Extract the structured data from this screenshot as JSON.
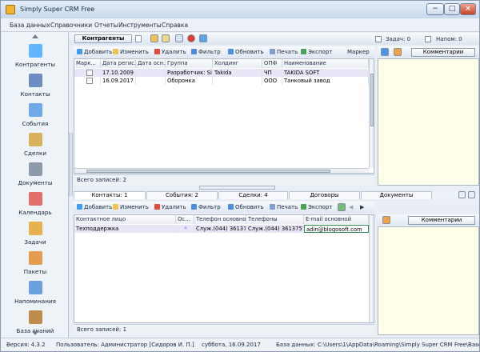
{
  "window": {
    "title": "Simply Super CRM Free",
    "min_label": "−",
    "max_label": "□",
    "close_label": "×"
  },
  "menu": [
    "База данных",
    "Справочники",
    "Отчеты",
    "Инструменты",
    "Справка"
  ],
  "sidebar": {
    "items": [
      {
        "label": "Контрагенты",
        "icon": "diamond-icon",
        "color": "#62b6ff"
      },
      {
        "label": "Контакты",
        "icon": "address-book-icon",
        "color": "#6f8cc2"
      },
      {
        "label": "События",
        "icon": "window-stack-icon",
        "color": "#6fa9e8"
      },
      {
        "label": "Сделки",
        "icon": "handshake-icon",
        "color": "#d8b35c"
      },
      {
        "label": "Документы",
        "icon": "documents-icon",
        "color": "#8d9aab"
      },
      {
        "label": "Календарь",
        "icon": "calendar-icon",
        "color": "#e26f69"
      },
      {
        "label": "Задачи",
        "icon": "person-task-icon",
        "color": "#e7b14d"
      },
      {
        "label": "Пакеты",
        "icon": "package-icon",
        "color": "#e49d4d"
      },
      {
        "label": "Напоминания",
        "icon": "speaker-icon",
        "color": "#6da0de"
      },
      {
        "label": "База знаний",
        "icon": "book-icon",
        "color": "#bf8c4b"
      }
    ]
  },
  "top": {
    "selector": "Контрагенты",
    "task_label": "Задач: 0",
    "reminder_label": "Напом: 0"
  },
  "upper": {
    "toolbar": [
      "Добавить",
      "Изменить",
      "Удалить",
      "Фильтр",
      "Обновить",
      "Печать",
      "Экспорт",
      "Маркер"
    ],
    "columns": [
      "Марк...",
      "Дата регис...",
      "Дата осн...",
      "Группа",
      "Холдинг",
      "ОПФ",
      "Наименование"
    ],
    "rows": [
      [
        "",
        "17.10.2009 14",
        "",
        "Разработчик: Simply",
        "Takida",
        "ЧП",
        "TAKIDA SOFT"
      ],
      [
        "",
        "16.09.2017 11",
        "",
        "Оборонка",
        "",
        "ООО",
        "Танковый завод"
      ]
    ],
    "footer": "Всего записей: 2"
  },
  "comments_label": "Комментарии",
  "tabs": [
    "Контакты: 1",
    "События: 2",
    "Сделки: 4",
    "Договоры",
    "Документы"
  ],
  "lower": {
    "toolbar": [
      "Добавить",
      "Изменить",
      "Удалить",
      "Фильтр",
      "Обновить",
      "Печать",
      "Экспорт"
    ],
    "columns": [
      "Контактное лицо",
      "Ос...",
      "Телефон основной",
      "Телефоны",
      "E-mail основной"
    ],
    "rows": [
      [
        "Техподдержка",
        "*",
        "Служ.(044) 3613757",
        "Служ.(044) 3613757",
        "adin@blogosoft.com"
      ]
    ],
    "footer": "Всего записей: 1"
  },
  "status": {
    "version": "Версия: 4.3.2",
    "user": "Пользователь: Администратор [Сидоров И. П.]",
    "date": "суббота, 16.09.2017",
    "db": "База данных: C:\\Users\\1\\AppData\\Roaming\\Simply Super CRM Free\\Base\\S"
  }
}
